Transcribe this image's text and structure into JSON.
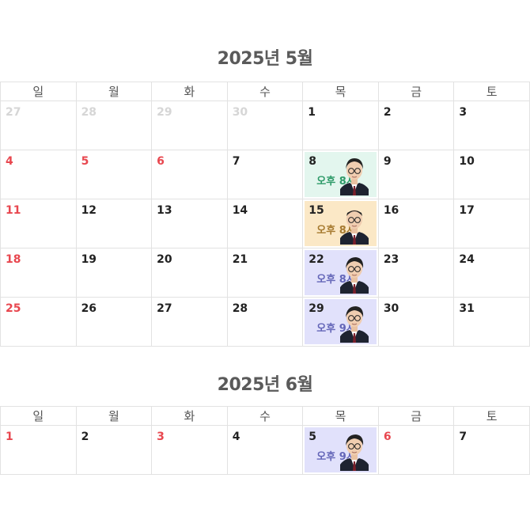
{
  "weekdays": [
    "일",
    "월",
    "화",
    "수",
    "목",
    "금",
    "토"
  ],
  "months": [
    {
      "title": "2025년 5월",
      "weeks": [
        [
          {
            "d": "27",
            "s": "muted"
          },
          {
            "d": "28",
            "s": "muted"
          },
          {
            "d": "29",
            "s": "muted"
          },
          {
            "d": "30",
            "s": "muted"
          },
          {
            "d": "1",
            "s": ""
          },
          {
            "d": "2",
            "s": ""
          },
          {
            "d": "3",
            "s": ""
          }
        ],
        [
          {
            "d": "4",
            "s": "red"
          },
          {
            "d": "5",
            "s": "red"
          },
          {
            "d": "6",
            "s": "red"
          },
          {
            "d": "7",
            "s": ""
          },
          {
            "d": "8",
            "s": "",
            "ev": {
              "time": "오후 8시",
              "color": "green",
              "person": "glasses-round"
            }
          },
          {
            "d": "9",
            "s": ""
          },
          {
            "d": "10",
            "s": ""
          }
        ],
        [
          {
            "d": "11",
            "s": "red"
          },
          {
            "d": "12",
            "s": ""
          },
          {
            "d": "13",
            "s": ""
          },
          {
            "d": "14",
            "s": ""
          },
          {
            "d": "15",
            "s": "",
            "ev": {
              "time": "오후 8시",
              "color": "orange",
              "person": "glasses-bald"
            }
          },
          {
            "d": "16",
            "s": ""
          },
          {
            "d": "17",
            "s": ""
          }
        ],
        [
          {
            "d": "18",
            "s": "red"
          },
          {
            "d": "19",
            "s": ""
          },
          {
            "d": "20",
            "s": ""
          },
          {
            "d": "21",
            "s": ""
          },
          {
            "d": "22",
            "s": "",
            "ev": {
              "time": "오후 8시",
              "color": "purple",
              "person": "glasses-side"
            }
          },
          {
            "d": "23",
            "s": ""
          },
          {
            "d": "24",
            "s": ""
          }
        ],
        [
          {
            "d": "25",
            "s": "red"
          },
          {
            "d": "26",
            "s": ""
          },
          {
            "d": "27",
            "s": ""
          },
          {
            "d": "28",
            "s": ""
          },
          {
            "d": "29",
            "s": "",
            "ev": {
              "time": "오후 9시",
              "color": "purple",
              "person": "glasses-side"
            }
          },
          {
            "d": "30",
            "s": ""
          },
          {
            "d": "31",
            "s": ""
          }
        ]
      ]
    },
    {
      "title": "2025년 6월",
      "weeks": [
        [
          {
            "d": "1",
            "s": "red"
          },
          {
            "d": "2",
            "s": ""
          },
          {
            "d": "3",
            "s": "red"
          },
          {
            "d": "4",
            "s": ""
          },
          {
            "d": "5",
            "s": "",
            "ev": {
              "time": "오후 9시",
              "color": "purple",
              "person": "glasses-side"
            }
          },
          {
            "d": "6",
            "s": "red"
          },
          {
            "d": "7",
            "s": ""
          }
        ]
      ]
    }
  ]
}
